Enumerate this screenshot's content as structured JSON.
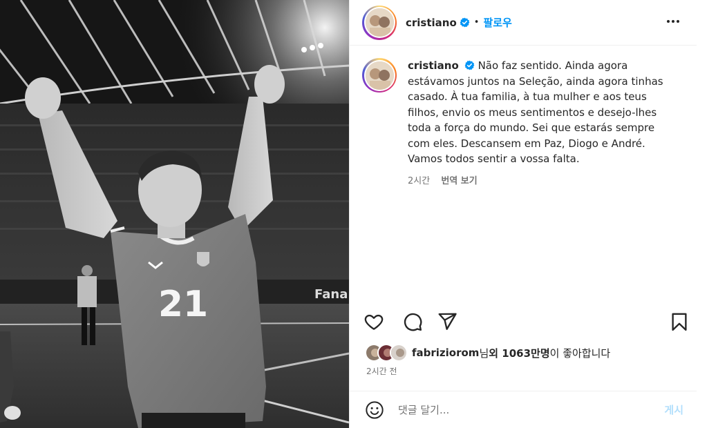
{
  "header": {
    "username": "cristiano",
    "verified_icon": "verified-badge-icon",
    "separator": "•",
    "follow_label": "팔로우",
    "more_icon": "more-options-icon"
  },
  "caption": {
    "username": "cristiano",
    "text": "Não faz sentido. Ainda agora estávamos juntos na Seleção, ainda agora tinhas casado. À tua familia, à tua mulher e aos teus filhos, envio os meus sentimentos e desejo-lhes toda a força do mundo. Sei que estarás sempre com eles. Descansem em Paz, Diogo e André. Vamos todos sentir a vossa falta.",
    "time": "2시간",
    "translate_label": "번역 보기"
  },
  "photo": {
    "jersey_number": "21",
    "banner_text": "Fana"
  },
  "actions": {
    "like_icon": "heart-icon",
    "comment_icon": "comment-icon",
    "share_icon": "share-icon",
    "save_icon": "bookmark-icon"
  },
  "likes": {
    "liker": "fabriziorom",
    "mid": "님 ",
    "count": "외 1063만명",
    "suffix": "이 좋아합니다"
  },
  "posted_time": "2시간 전",
  "comment": {
    "emoji_icon": "emoji-icon",
    "placeholder": "댓글 달기...",
    "post_label": "게시"
  },
  "colors": {
    "accent": "#0095f6",
    "post_disabled": "#b2dffc",
    "muted": "#737373"
  }
}
